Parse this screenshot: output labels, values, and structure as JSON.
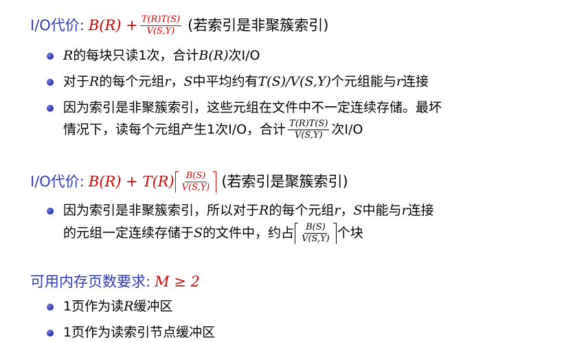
{
  "section1": {
    "cost_label": "I/O代价:",
    "formula_a": "B(R) +",
    "frac_num": "T(R)T(S)",
    "frac_den": "V(S,Y)",
    "condition": "(若索引是非聚簇索引)",
    "bullets": [
      {
        "a": "R",
        "b": "的每块只读1次，合计",
        "c": "B(R)",
        "d": "次I/O"
      },
      {
        "a": "对于",
        "b": "R",
        "c": "的每个元组",
        "d": "r",
        "e": "，",
        "f": "S",
        "g": "中平均约有",
        "h": "T(S)/V(S,Y)",
        "i": "个元组能与",
        "j": "r",
        "k": "连接"
      },
      {
        "line1": "因为索引是非聚簇索引，这些元组在文件中不一定连续存储。最坏",
        "line2a": "情况下，读每个元组产生1次I/O，合计",
        "frac_num": "T(R)T(S)",
        "frac_den": "V(S,Y)",
        "line2b": "次I/O"
      }
    ]
  },
  "section2": {
    "cost_label": "I/O代价:",
    "formula_a": "B(R) + T(R)",
    "frac_num": "B(S)",
    "frac_den": "V(S,Y)",
    "condition": "(若索引是聚簇索引)",
    "bullet": {
      "l1a": "因为索引是非聚簇索引，所以对于",
      "l1b": "R",
      "l1c": "的每个元组",
      "l1d": "r",
      "l1e": "，",
      "l1f": "S",
      "l1g": "中能与",
      "l1h": "r",
      "l1i": "连接",
      "l2a": "的元组一定连续存储于",
      "l2b": "S",
      "l2c": "的文件中，约占",
      "frac_num": "B(S)",
      "frac_den": "V(S,Y)",
      "l2d": "个块"
    }
  },
  "section3": {
    "label": "可用内存页数要求:",
    "formula": "M ≥ 2",
    "bullets": [
      {
        "a": "1页作为读",
        "b": "R",
        "c": "缓冲区"
      },
      {
        "a": "1页作为读索引节点缓冲区"
      }
    ]
  },
  "colors": {
    "heading": "#2f3bb7",
    "formula": "#d40000",
    "bullet": "#2f3bb7"
  }
}
